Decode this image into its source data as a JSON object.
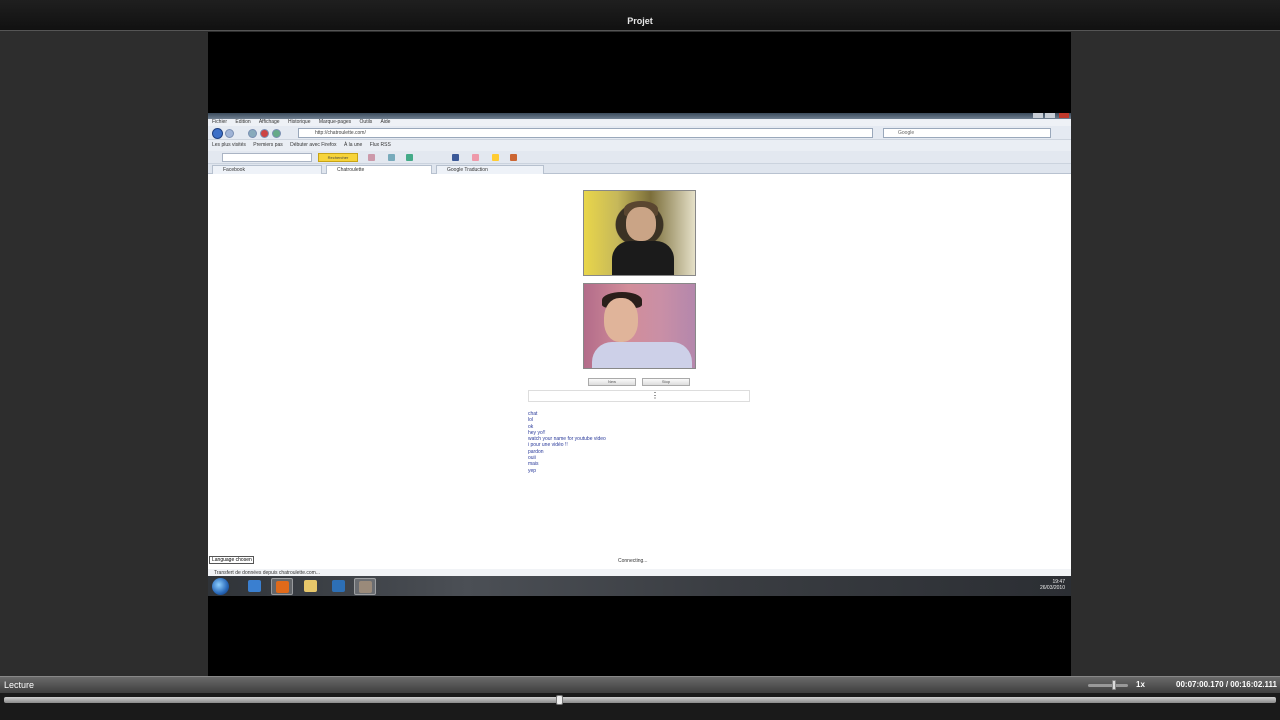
{
  "window": {
    "title": "Projet"
  },
  "browser": {
    "menu": [
      "Fichier",
      "Édition",
      "Affichage",
      "Historique",
      "Marque-pages",
      "Outils",
      "Aide"
    ],
    "url": "http://chatroulette.com/",
    "search_placeholder": "Google",
    "favorites": [
      "Les plus visités",
      "Premiers pas",
      "Débuter avec Firefox",
      "À la une",
      "Flux RSS"
    ],
    "toolbar_button": "Rechercher",
    "tabs": [
      "Facebook",
      "Chatroulette",
      "Google Traduction"
    ],
    "status": "Transfert de données depuis chatroulette.com..."
  },
  "page": {
    "buttons": [
      "New",
      "Stop"
    ],
    "chat_log": [
      "chat",
      "lol",
      "ok",
      "hey yo!!",
      "watch your name for youtube video",
      "i pour une vidéo !!",
      "pardon",
      "ouii",
      "mais",
      "yep"
    ],
    "status_left": "Language chosen",
    "status_mid": "Connecting..."
  },
  "taskbar": {
    "time": "19:47",
    "date": "26/03/2010"
  },
  "player": {
    "mode_label": "Lecture",
    "speed": "1x",
    "time_display": "00:07:00.170 / 00:16:02.111",
    "progress_fraction": 0.437,
    "volume_fraction": 0.65
  }
}
